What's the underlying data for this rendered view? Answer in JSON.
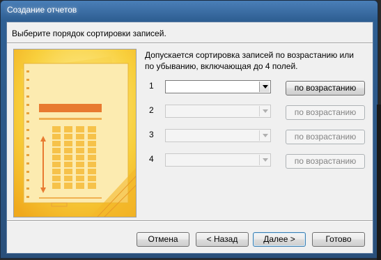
{
  "window": {
    "title": "Создание отчетов"
  },
  "header": {
    "instruction": "Выберите порядок сортировки записей."
  },
  "description": "Допускается сортировка записей по возрастанию или по убыванию, включающая до 4 полей.",
  "sort_rows": [
    {
      "number": "1",
      "field_value": "",
      "order_label": "по возрастанию",
      "enabled": true
    },
    {
      "number": "2",
      "field_value": "",
      "order_label": "по возрастанию",
      "enabled": false
    },
    {
      "number": "3",
      "field_value": "",
      "order_label": "по возрастанию",
      "enabled": false
    },
    {
      "number": "4",
      "field_value": "",
      "order_label": "по возрастанию",
      "enabled": false
    }
  ],
  "buttons": {
    "cancel": "Отмена",
    "back": "< Назад",
    "next": "Далее >",
    "finish": "Готово"
  },
  "colors": {
    "illustration_bg": "#f7c531",
    "illustration_paper": "#fbe48a",
    "illustration_accent": "#e8762a"
  }
}
